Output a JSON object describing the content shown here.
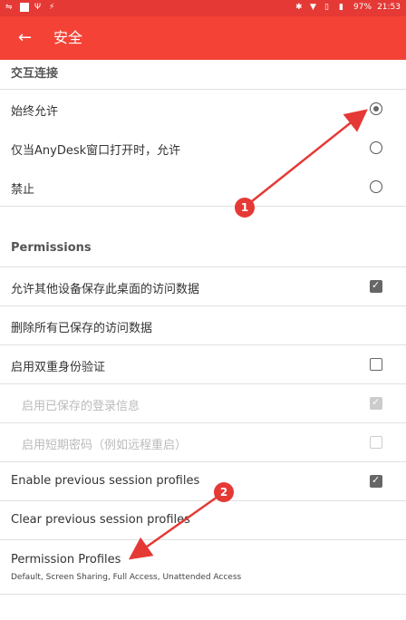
{
  "status": {
    "battery": "97%",
    "time": "21:53"
  },
  "appbar": {
    "title": "安全"
  },
  "sections": {
    "interactive": "交互连接",
    "permissions": "Permissions"
  },
  "options": {
    "always_allow": "始终允许",
    "allow_when_open": "仅当AnyDesk窗口打开时，允许",
    "deny": "禁止"
  },
  "permissions": {
    "save_access": "允许其他设备保存此桌面的访问数据",
    "delete_saved": "删除所有已保存的访问数据",
    "two_factor": "启用双重身份验证",
    "enable_saved_login": "启用已保存的登录信息",
    "enable_short_password": "启用短期密码（例如远程重启）",
    "enable_prev_profiles": "Enable previous session profiles",
    "clear_prev_profiles": "Clear previous session profiles",
    "permission_profiles": "Permission Profiles",
    "permission_profiles_sub": "Default, Screen Sharing, Full Access, Unattended Access"
  },
  "markers": {
    "one": "1",
    "two": "2"
  },
  "colors": {
    "appbar": "#f44336",
    "statusbar": "#e53935",
    "annotation": "#e53935"
  }
}
